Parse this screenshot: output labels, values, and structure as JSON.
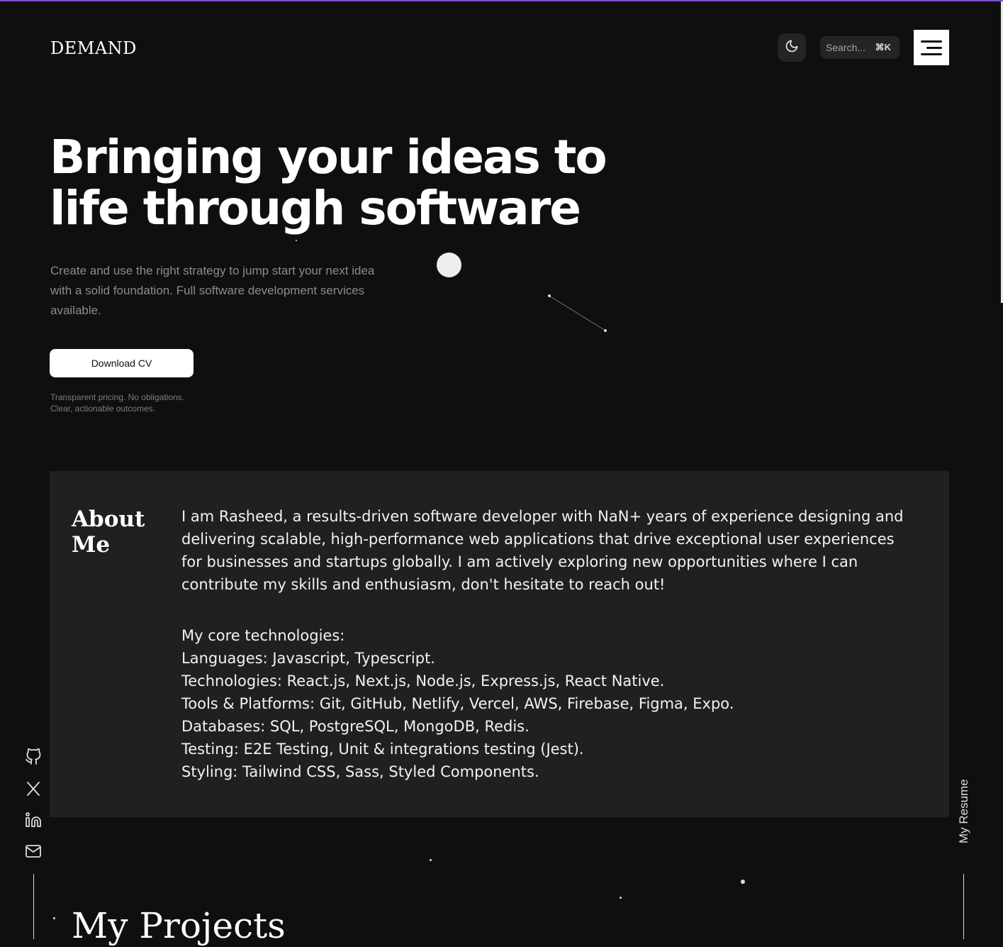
{
  "header": {
    "logo": "DEMAND",
    "search_placeholder": "Search...",
    "search_shortcut": "⌘K"
  },
  "hero": {
    "title_line1": "Bringing your ideas to",
    "title_line2": "life through software",
    "description": "Create and use the right strategy to jump start your next idea with a solid foundation. Full software development services available.",
    "cta_label": "Download CV",
    "note_line1": "Transparent pricing. No obligations.",
    "note_line2": "Clear, actionable outcomes."
  },
  "about": {
    "title_line1": "About",
    "title_line2": "Me",
    "intro": "I am Rasheed, a results-driven software developer with NaN+ years of experience designing and delivering scalable, high-performance web applications that drive exceptional user experiences for businesses and startups globally. I am actively exploring new opportunities where I can contribute my skills and enthusiasm, don't hesitate to reach out!",
    "tech_heading": "My core technologies:",
    "tech_lines": [
      "Languages: Javascript, Typescript.",
      "Technologies: React.js, Next.js, Node.js, Express.js, React Native.",
      "Tools & Platforms: Git, GitHub, Netlify, Vercel, AWS, Firebase, Figma, Expo.",
      "Databases: SQL, PostgreSQL, MongoDB, Redis.",
      "Testing: E2E Testing, Unit & integrations testing (Jest).",
      "Styling: Tailwind CSS, Sass, Styled Components."
    ]
  },
  "social": {
    "icons": [
      "github-icon",
      "x-icon",
      "linkedin-icon",
      "mail-icon"
    ]
  },
  "sidebar": {
    "resume_label": "My Resume"
  },
  "projects": {
    "title": "My Projects"
  },
  "colors": {
    "background": "#0f0f10",
    "panel": "#202020",
    "accent_line": "#7b4fc9",
    "text": "#ffffff",
    "muted": "#8c8c8c"
  }
}
